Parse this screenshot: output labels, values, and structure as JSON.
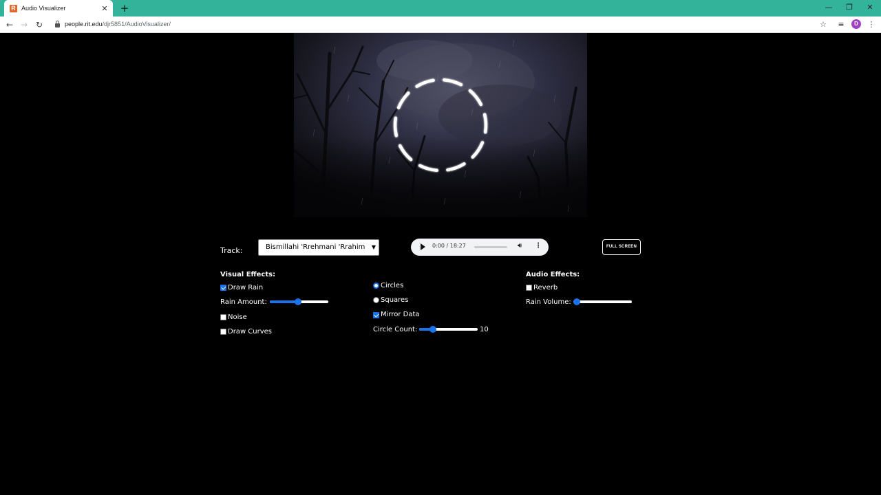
{
  "browser": {
    "tab_title": "Audio Visualizer",
    "favicon_letter": "R",
    "tab_close": "✕",
    "new_tab": "+",
    "url_host": "people.rit.edu",
    "url_path": "/djr5851/AudioVisualizer/",
    "avatar_letter": "D",
    "window_controls": {
      "minimize": "—",
      "restore": "❐",
      "close": "✕"
    }
  },
  "controls": {
    "track_label": "Track:",
    "track_selected": "Bismillahi 'Rrehmani 'Rrahim",
    "audio": {
      "time": "0:00 / 18:27",
      "progress": 0
    },
    "fullscreen_label": "FULL SCREEN"
  },
  "visual_effects": {
    "heading": "Visual Effects:",
    "draw_rain": {
      "label": "Draw Rain",
      "checked": true
    },
    "rain_amount": {
      "label": "Rain Amount:",
      "value": 0.48
    },
    "noise": {
      "label": "Noise",
      "checked": false
    },
    "draw_curves": {
      "label": "Draw Curves",
      "checked": false
    }
  },
  "shape_effects": {
    "circles": {
      "label": "Circles",
      "selected": true
    },
    "squares": {
      "label": "Squares",
      "selected": false
    },
    "mirror_data": {
      "label": "Mirror Data",
      "checked": true
    },
    "circle_count": {
      "label": "Circle Count:",
      "value": 10,
      "fraction": 0.2
    }
  },
  "audio_effects": {
    "heading": "Audio Effects:",
    "reverb": {
      "label": "Reverb",
      "checked": false
    },
    "rain_volume": {
      "label": "Rain Volume:",
      "value": 0.0
    }
  },
  "colors": {
    "tab_bar": "#33b399",
    "accent": "#1a73e8",
    "background": "#000000"
  }
}
